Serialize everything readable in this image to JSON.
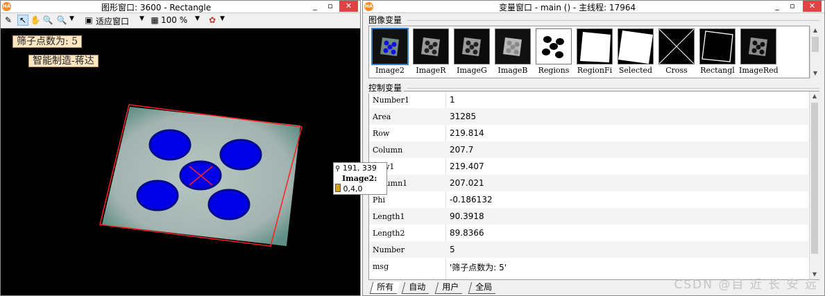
{
  "left_window": {
    "title": "图形窗口: 3600 - Rectangle",
    "toolbar": {
      "fit_label": "适应窗口",
      "zoom_label": "100 %"
    },
    "display_messages": [
      "筛子点数为: 5",
      "智能制造-蒋达"
    ],
    "tooltip": {
      "coords": "191, 339",
      "image_name": "Image2:",
      "value": "0,4,0"
    }
  },
  "right_window": {
    "title": "变量窗口 - main () - 主线程: 17964",
    "image_vars_label": "图像变量",
    "control_vars_label": "控制变量",
    "image_vars": [
      {
        "name": "Image2",
        "icon": "dice-blue-dots-thumbnail"
      },
      {
        "name": "ImageR",
        "icon": "dice-gray-thumbnail"
      },
      {
        "name": "ImageG",
        "icon": "dice-gray-thumbnail"
      },
      {
        "name": "ImageB",
        "icon": "dice-light-thumbnail"
      },
      {
        "name": "Regions",
        "icon": "dots-regions-thumbnail"
      },
      {
        "name": "RegionFi",
        "icon": "white-square-thumbnail"
      },
      {
        "name": "Selected",
        "icon": "white-rotated-square-thumbnail"
      },
      {
        "name": "Cross",
        "icon": "cross-thumbnail"
      },
      {
        "name": "Rectangl",
        "icon": "rectangle-outline-thumbnail"
      },
      {
        "name": "ImageRed",
        "icon": "dice-dark-thumbnail"
      }
    ],
    "control_vars": [
      {
        "name": "Number1",
        "value": "1"
      },
      {
        "name": "Area",
        "value": "31285"
      },
      {
        "name": "Row",
        "value": "219.814"
      },
      {
        "name": "Column",
        "value": "207.7"
      },
      {
        "name": "Row1",
        "value": "219.407"
      },
      {
        "name": "Column1",
        "value": "207.021"
      },
      {
        "name": "Phi",
        "value": "-0.186132"
      },
      {
        "name": "Length1",
        "value": "90.3918"
      },
      {
        "name": "Length2",
        "value": "89.8366"
      },
      {
        "name": "Number",
        "value": "5"
      },
      {
        "name": "msg",
        "value": "'筛子点数为: 5'"
      }
    ],
    "tabs": [
      "所有",
      "自动",
      "用户",
      "全局"
    ]
  },
  "watermark": "CSDN @目 近 长 安 远",
  "colors": {
    "region_outline": "#ff2020",
    "dot_fill": "#0000e6",
    "die_face": "#a9b9b5",
    "selection_accent": "#3c7fc3"
  }
}
